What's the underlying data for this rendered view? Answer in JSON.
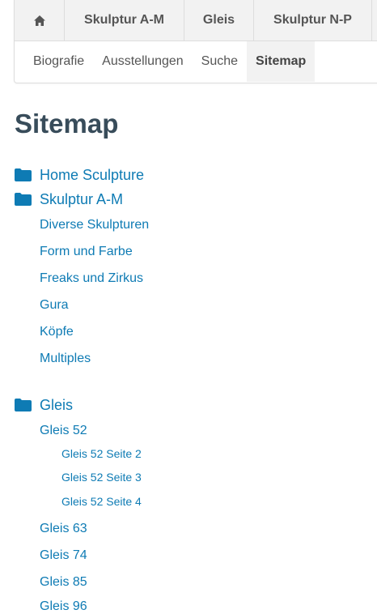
{
  "nav": {
    "home_icon": "home-icon",
    "tabs": [
      "Skulptur A-M",
      "Gleis",
      "Skulptur N-P"
    ],
    "subtabs": [
      "Biografie",
      "Ausstellungen",
      "Suche",
      "Sitemap"
    ],
    "active_subtab": "Sitemap"
  },
  "page": {
    "title": "Sitemap"
  },
  "colors": {
    "link": "#0e7bb4",
    "folder_icon": "#0e7bb4",
    "title": "#384c5a",
    "nav_bg": "#f2f2f2"
  },
  "sitemap": {
    "home": "Home Sculpture",
    "skulptur": {
      "label": "Skulptur A-M",
      "items": [
        "Diverse Skulpturen",
        "Form und Farbe",
        "Freaks und Zirkus",
        "Gura",
        "Köpfe",
        "Multiples"
      ]
    },
    "gleis": {
      "label": "Gleis",
      "items": [
        {
          "label": "Gleis 52",
          "children": [
            "Gleis 52 Seite 2",
            "Gleis 52 Seite 3",
            "Gleis 52 Seite 4"
          ]
        },
        {
          "label": "Gleis 63"
        },
        {
          "label": "Gleis 74"
        },
        {
          "label": "Gleis 85"
        },
        {
          "label": "Gleis 96"
        }
      ]
    }
  }
}
